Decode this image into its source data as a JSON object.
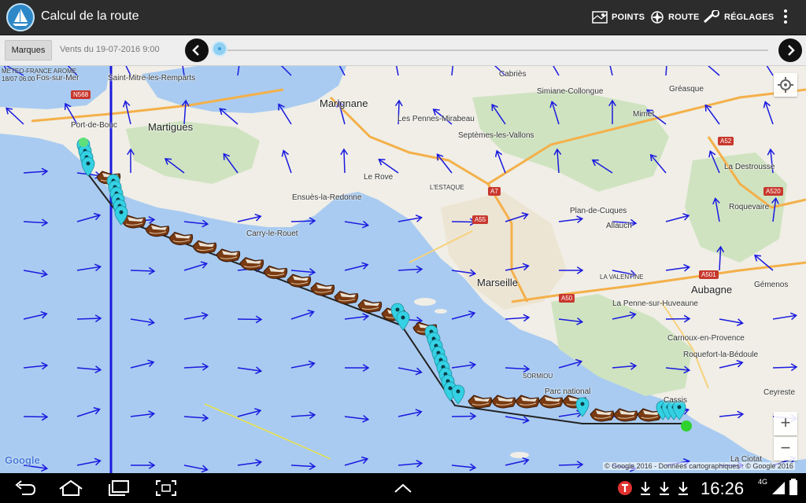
{
  "app": {
    "title": "Calcul de la route",
    "actions": [
      {
        "label": "POINTS",
        "icon": "map-points-icon"
      },
      {
        "label": "ROUTE",
        "icon": "compass-icon"
      },
      {
        "label": "RÉGLAGES",
        "icon": "wrench-icon"
      }
    ],
    "overflow_icon": "more-vert-icon"
  },
  "timebar": {
    "marques_label": "Marques",
    "winds_label": "Vents du 19-07-2016 9:00",
    "slider_position": 0.0
  },
  "map": {
    "model_line1": "METEO-FRANCE AROME",
    "model_line2": "18/07 06:00",
    "google_logo": "Google",
    "copyright": "© Google 2016 - Données cartographiques : © Google 2016",
    "places": [
      "Fos-sur-Mer",
      "Saint-Mitre-les-Remparts",
      "Port-de-Bouc",
      "Martigues",
      "Marignane",
      "Les Pennes-Mirabeau",
      "Septèmes-les-Vallons",
      "Le Rove",
      "Ensuès-la-Redonne",
      "Carry-le-Rouet",
      "Marseille",
      "Cabriès",
      "Simiane-Collongue",
      "Gréasque",
      "Mimet",
      "La Destrousse",
      "Roquevaire",
      "Plan-de-Cuques",
      "Allauch",
      "Aubagne",
      "La Penne-sur-Huveaune",
      "Gémenos",
      "Carnoux-en-Provence",
      "Roquefort-la-Bédoule",
      "Ceyreste",
      "La Ciotat",
      "Parc national",
      "SORMIOU",
      "LA VALENTINE",
      "L'ESTAQUE",
      "Cassis"
    ],
    "roads": [
      "N568",
      "A7",
      "A55",
      "A50",
      "A501",
      "A52",
      "A520"
    ],
    "route_color": "#222222",
    "wind_arrow_color": "#1a1adf",
    "marker_color": "#34d1e4"
  },
  "system": {
    "time": "16:26",
    "network": "4G"
  }
}
